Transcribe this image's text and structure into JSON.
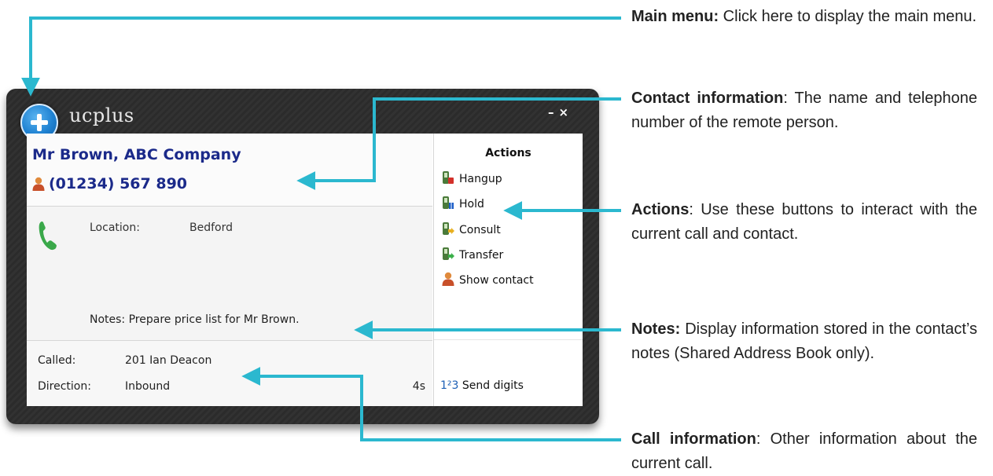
{
  "window": {
    "app_title": "ucplus",
    "minimize_label": "–",
    "close_label": "×"
  },
  "contact": {
    "name": "Mr Brown, ABC Company",
    "phone": "(01234) 567 890"
  },
  "details": {
    "location_label": "Location:",
    "location_value": "Bedford",
    "notes": "Notes: Prepare price list for Mr Brown."
  },
  "call_info": {
    "called_label": "Called:",
    "called_value": "201  Ian Deacon",
    "direction_label": "Direction:",
    "direction_value": "Inbound",
    "duration": "4s"
  },
  "actions": {
    "title": "Actions",
    "items": [
      {
        "label": "Hangup",
        "icon": "hangup-icon"
      },
      {
        "label": "Hold",
        "icon": "hold-icon"
      },
      {
        "label": "Consult",
        "icon": "consult-icon"
      },
      {
        "label": "Transfer",
        "icon": "transfer-icon"
      },
      {
        "label": "Show contact",
        "icon": "contact-icon"
      }
    ],
    "send_digits_num": "1²3",
    "send_digits_label": "Send digits"
  },
  "callouts": [
    {
      "title": "Main menu:",
      "text": " Click here to display the main menu."
    },
    {
      "title": "Contact information",
      "text": ": The name and telephone number of the remote person."
    },
    {
      "title": "Actions",
      "text": ": Use these buttons to interact with the current call and contact."
    },
    {
      "title": "Notes:",
      "text": " Display information stored in the contact’s notes (Shared Address Book only)."
    },
    {
      "title": "Call information",
      "text": ": Other information about the current call."
    }
  ],
  "colors": {
    "callout_line": "#2bb8cf",
    "contact_text": "#1b2a8a",
    "menu_button": "#1f82d2"
  }
}
